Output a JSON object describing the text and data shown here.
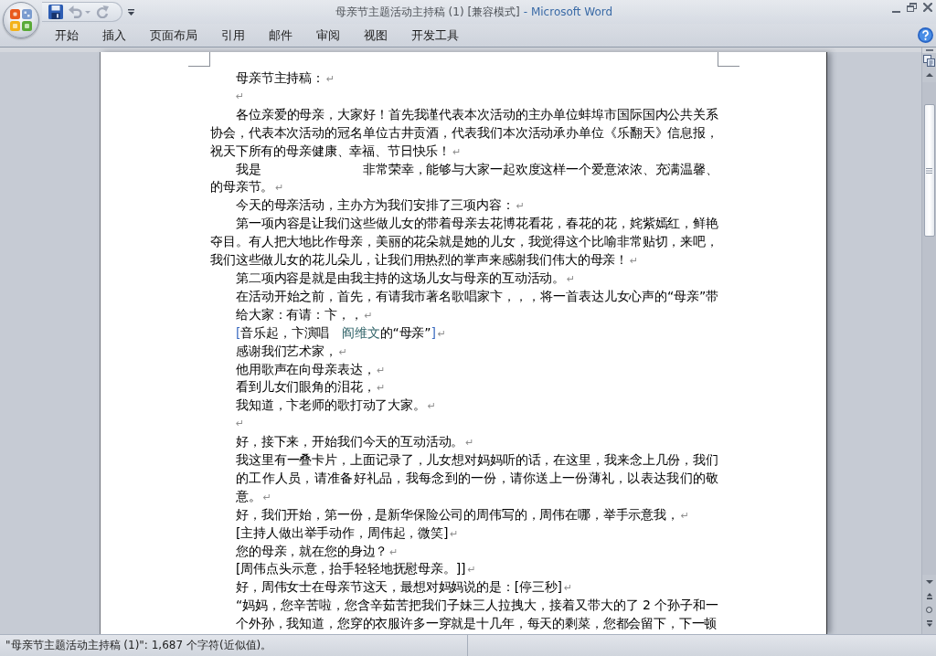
{
  "window": {
    "title": "母亲节主题活动主持稿 (1) [兼容模式]",
    "app_name": "- Microsoft Word"
  },
  "quick_access": [
    {
      "kind": "save",
      "disabled": false,
      "has_menu": false
    },
    {
      "kind": "undo",
      "disabled": true,
      "has_menu": true
    },
    {
      "kind": "redo",
      "disabled": true,
      "has_menu": false
    }
  ],
  "ribbon_tabs": [
    {
      "label": "开始",
      "selected": false
    },
    {
      "label": "插入",
      "selected": false
    },
    {
      "label": "页面布局",
      "selected": false
    },
    {
      "label": "引用",
      "selected": false
    },
    {
      "label": "邮件",
      "selected": false
    },
    {
      "label": "审阅",
      "selected": false
    },
    {
      "label": "视图",
      "selected": false
    },
    {
      "label": "开发工具",
      "selected": false
    }
  ],
  "document": {
    "paragraphs": [
      {
        "kind": "first_line",
        "text": "母亲节主持稿：",
        "mark": "↵"
      },
      {
        "kind": "first_line",
        "mark": "↵"
      },
      {
        "kind": "first_line",
        "text": "各位亲爱的母亲，大家好！首先我谨代表本次活动的主办单位蚌埠市国际国内公共关系协会，代表本次活动的冠名单位古井贡酒，代表我们本次活动承办单位《乐翻天》信息报，祝天下所有的母亲健康、幸福、节日快乐！",
        "mark": "↵"
      },
      {
        "kind": "first_line",
        "text": "我是　　　　　　　　非常荣幸，能够与大家一起欢度这样一个爱意浓浓、充满温馨、的母亲节。",
        "mark": "↵"
      },
      {
        "kind": "first_line",
        "text": "今天的母亲活动，主办方为我们安排了三项内容：",
        "mark": "↵"
      },
      {
        "kind": "first_line",
        "text": "第一项内容是让我们这些做儿女的带着母亲去花博花看花，春花的花，姹紫嫣红，鲜艳夺目。有人把大地比作母亲，美丽的花朵就是她的儿女，我觉得这个比喻非常贴切，来吧，我们这些做儿女的花儿朵儿，让我们用热烈的掌声来感谢我们伟大的母亲！",
        "mark": "↵"
      },
      {
        "kind": "left",
        "text": "第二项内容是就是由我主持的这场儿女与母亲的互动活动。",
        "mark": "↵"
      },
      {
        "kind": "left",
        "text": "在活动开始之前，首先，有请我市著名歌唱家卞，，，将一首表达儿女心声的“母亲”带给大家：有请：卞，，",
        "mark": "↵"
      },
      {
        "kind": "left",
        "runs": [
          {
            "text": "[",
            "kind": "marker"
          },
          {
            "text": "音乐起，卞演唱　",
            "kind": "plain"
          },
          {
            "text": "阎维文",
            "kind": "accent"
          },
          {
            "text": "的“母亲”",
            "kind": "plain"
          },
          {
            "text": "]",
            "kind": "marker"
          }
        ],
        "mark": "↵"
      },
      {
        "kind": "left",
        "text": "感谢我们艺术家，",
        "mark": "↵"
      },
      {
        "kind": "left",
        "text": "他用歌声在向母亲表达，",
        "mark": "↵"
      },
      {
        "kind": "left",
        "text": "看到儿女们眼角的泪花，",
        "mark": "↵"
      },
      {
        "kind": "left",
        "text": "我知道，卞老师的歌打动了大家。",
        "mark": "↵"
      },
      {
        "kind": "left",
        "mark": "↵"
      },
      {
        "kind": "left",
        "text": "好，接下来，开始我们今天的互动活动。",
        "mark": "↵"
      },
      {
        "kind": "left",
        "text": "我这里有一叠卡片，上面记录了，儿女想对妈妈听的话，在这里，我来念上几份，我们的工作人员，请准备好礼品，我每念到的一份，请你送上一份薄礼，以表达我们的敬意。",
        "mark": "↵"
      },
      {
        "kind": "left",
        "text": "好，我们开始，第一份，是新华保险公司的周伟写的，周伟在哪，举手示意我，",
        "mark": "↵"
      },
      {
        "kind": "left",
        "text": "[主持人做出举手动作，周伟起，微笑]",
        "mark": "↵"
      },
      {
        "kind": "left",
        "text": "您的母亲，就在您的身边？",
        "mark": "↵"
      },
      {
        "kind": "left",
        "text": "[周伟点头示意，抬手轻轻地抚慰母亲。]]",
        "mark": "↵"
      },
      {
        "kind": "left",
        "text": "好，周伟女士在母亲节这天，最想对妈妈说的是：[停三秒]",
        "mark": "↵"
      },
      {
        "kind": "left",
        "text": "“妈妈，您辛苦啦，您含辛茹苦把我们子妹三人拉拽大，接着又带大的了 2 个孙子和一个外孙，我知道，您穿的衣服许多一穿就是十几年，每天的剩菜，您都会留下，下一顿"
      }
    ]
  },
  "status_bar": {
    "text": "\"母亲节主题活动主持稿 (1)\": 1,687 个字符(近似值)。"
  }
}
